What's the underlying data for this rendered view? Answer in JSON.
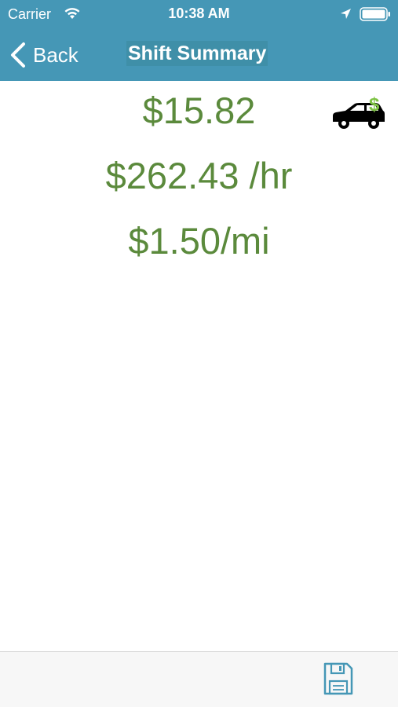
{
  "status_bar": {
    "carrier": "Carrier",
    "time": "10:38 AM"
  },
  "nav": {
    "back_label": "Back",
    "title": "Shift Summary"
  },
  "metrics": {
    "total": "$15.82",
    "per_hour": "$262.43 /hr",
    "per_mile": "$1.50/mi"
  },
  "colors": {
    "header_bg": "#4597b6",
    "metric_text": "#5b8a3c",
    "dollar_accent": "#7cc242",
    "toolbar_icon": "#4597b6"
  },
  "icons": {
    "status": [
      "wifi-icon",
      "location-icon",
      "battery-icon"
    ],
    "back": "chevron-left-icon",
    "badge": "car-dollar-icon",
    "toolbar": "save-icon"
  }
}
